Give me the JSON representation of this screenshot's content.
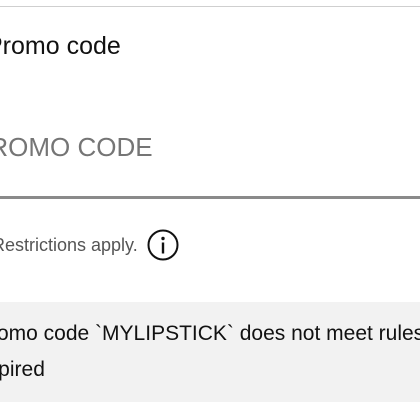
{
  "promo": {
    "label": "Promo code",
    "placeholder": "PROMO CODE",
    "restrictions_text": "Restrictions apply.",
    "info_icon": "info-circle-icon"
  },
  "error": {
    "line1": "Promo code `MYLIPSTICK` does not meet rules -",
    "line2": "expired"
  },
  "colors": {
    "underline": "#8a8a8a",
    "error_background": "#f2f2f2",
    "muted_text": "#555555"
  }
}
